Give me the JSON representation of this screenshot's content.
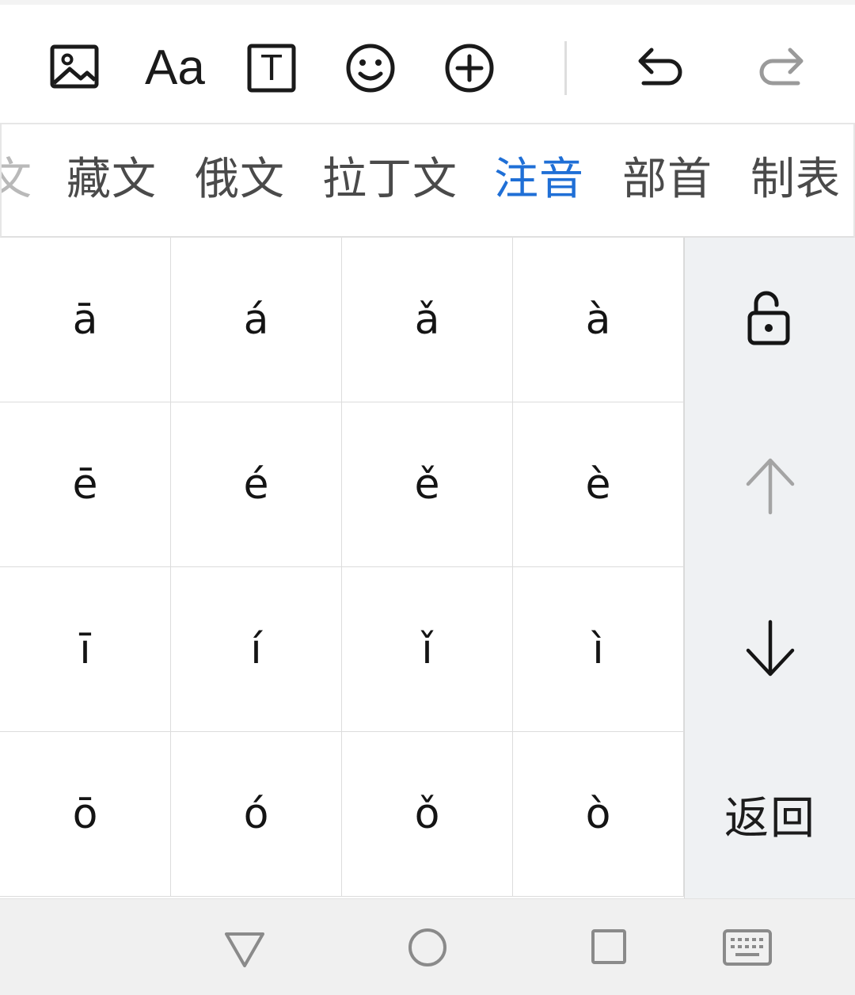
{
  "toolbar": {
    "icons": [
      "image-icon",
      "text-format-icon",
      "text-box-icon",
      "emoji-icon",
      "add-icon",
      "undo-icon",
      "redo-icon"
    ],
    "font_label": "Aa",
    "textbox_glyph": "T"
  },
  "tabs": [
    {
      "label": "文",
      "state": "partial"
    },
    {
      "label": "藏文",
      "state": "normal"
    },
    {
      "label": "俄文",
      "state": "normal"
    },
    {
      "label": "拉丁文",
      "state": "normal"
    },
    {
      "label": "注音",
      "state": "active"
    },
    {
      "label": "部首",
      "state": "normal"
    },
    {
      "label": "制表",
      "state": "normal"
    }
  ],
  "keys": [
    [
      "ā",
      "á",
      "ǎ",
      "à"
    ],
    [
      "ē",
      "é",
      "ě",
      "è"
    ],
    [
      "ī",
      "í",
      "ǐ",
      "ì"
    ],
    [
      "ō",
      "ó",
      "ǒ",
      "ò"
    ]
  ],
  "side_panel": {
    "icons": [
      "unlock-icon",
      "arrow-up-icon",
      "arrow-down-icon"
    ],
    "back_label": "返回"
  },
  "navbar": {
    "icons": [
      "back-triangle-icon",
      "home-circle-icon",
      "recents-square-icon",
      "keyboard-icon"
    ]
  },
  "colors": {
    "active_tab": "#1f6fd6",
    "tab_text": "#4a4a4a",
    "side_panel_bg": "#eff1f3",
    "navbar_bg": "#f0f0f0",
    "redo_disabled": "#9a9a9a",
    "arrow_up_disabled": "#a4a4a4"
  }
}
